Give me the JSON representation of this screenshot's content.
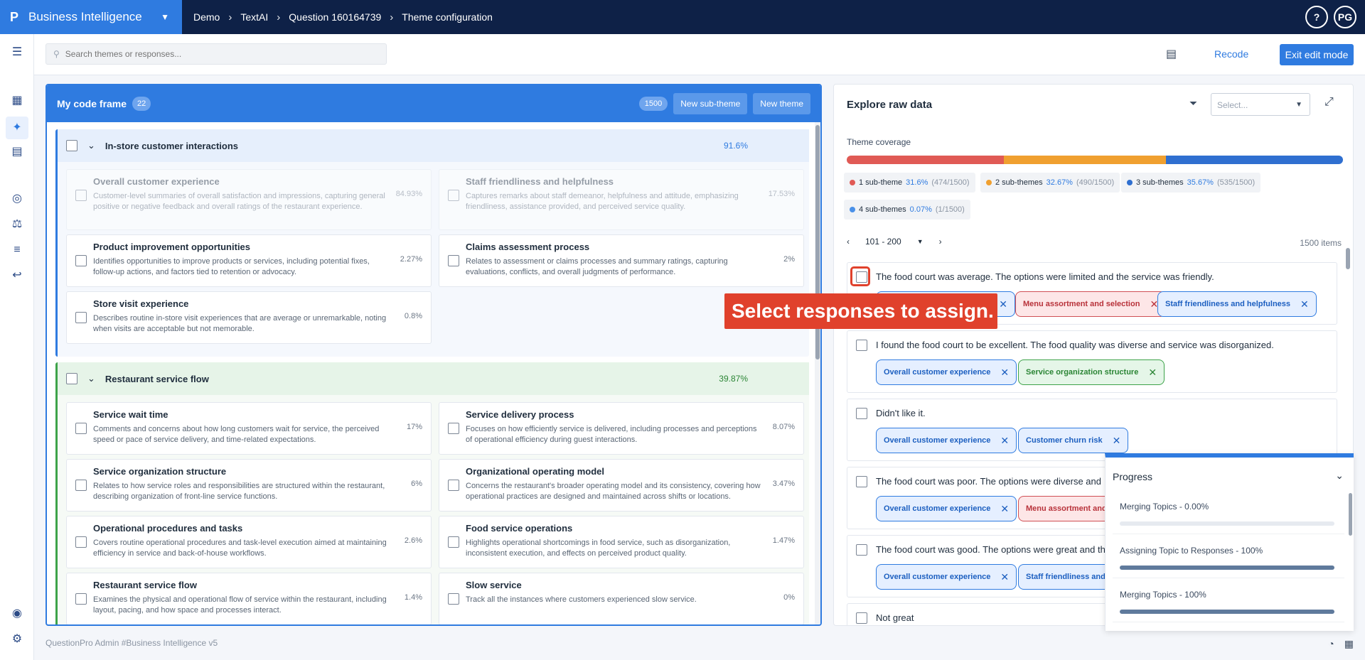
{
  "app": {
    "logo": "P",
    "name": "Business Intelligence"
  },
  "breadcrumbs": [
    "Demo",
    "TextAI",
    "Question 160164739",
    "Theme configuration"
  ],
  "topbar": {
    "help": "?",
    "user_initials": "PG"
  },
  "toolbar": {
    "search_placeholder": "Search themes or responses...",
    "recode": "Recode",
    "exit": "Exit edit mode"
  },
  "codeframe": {
    "title": "My code frame",
    "badge": "22",
    "count": "1500",
    "new_sub_theme": "New sub-theme",
    "new_theme": "New theme",
    "groups": [
      {
        "title": "In-store customer interactions",
        "pct": "91.6%",
        "subs": [
          {
            "title": "Overall customer experience",
            "desc": "Customer-level summaries of overall satisfaction and impressions, capturing general positive or negative feedback and overall ratings of the restaurant experience.",
            "pct": "84.93%"
          },
          {
            "title": "Staff friendliness and helpfulness",
            "desc": "Captures remarks about staff demeanor, helpfulness and attitude, emphasizing friendliness, assistance provided, and perceived service quality.",
            "pct": "17.53%"
          },
          {
            "title": "Product improvement opportunities",
            "desc": "Identifies opportunities to improve products or services, including potential fixes, follow-up actions, and factors tied to retention or advocacy.",
            "pct": "2.27%"
          },
          {
            "title": "Claims assessment process",
            "desc": "Relates to assessment or claims processes and summary ratings, capturing evaluations, conflicts, and overall judgments of performance.",
            "pct": "2%"
          },
          {
            "title": "Store visit experience",
            "desc": "Describes routine in-store visit experiences that are average or unremarkable, noting when visits are acceptable but not memorable.",
            "pct": "0.8%"
          }
        ]
      },
      {
        "title": "Restaurant service flow",
        "pct": "39.87%",
        "subs": [
          {
            "title": "Service wait time",
            "desc": "Comments and concerns about how long customers wait for service, the perceived speed or pace of service delivery, and time-related expectations.",
            "pct": "17%"
          },
          {
            "title": "Service delivery process",
            "desc": "Focuses on how efficiently service is delivered, including processes and perceptions of operational efficiency during guest interactions.",
            "pct": "8.07%"
          },
          {
            "title": "Service organization structure",
            "desc": "Relates to how service roles and responsibilities are structured within the restaurant, describing organization of front-line service functions.",
            "pct": "6%"
          },
          {
            "title": "Organizational operating model",
            "desc": "Concerns the restaurant's broader operating model and its consistency, covering how operational practices are designed and maintained across shifts or locations.",
            "pct": "3.47%"
          },
          {
            "title": "Operational procedures and tasks",
            "desc": "Covers routine operational procedures and task-level execution aimed at maintaining efficiency in service and back-of-house workflows.",
            "pct": "2.6%"
          },
          {
            "title": "Food service operations",
            "desc": "Highlights operational shortcomings in food service, such as disorganization, inconsistent execution, and effects on perceived product quality.",
            "pct": "1.47%"
          },
          {
            "title": "Restaurant service flow",
            "desc": "Examines the physical and operational flow of service within the restaurant, including layout, pacing, and how space and processes interact.",
            "pct": "1.4%"
          },
          {
            "title": "Slow service",
            "desc": "Track all the instances where customers experienced slow service.",
            "pct": "0%"
          }
        ]
      }
    ]
  },
  "explore": {
    "title": "Explore raw data",
    "select_placeholder": "Select...",
    "coverage_label": "Theme coverage",
    "coverage": [
      {
        "label": "1 sub-theme",
        "pct": "31.6%",
        "count": "(474/1500)",
        "fraction": 0.316,
        "color": "#e05a55"
      },
      {
        "label": "2 sub-themes",
        "pct": "32.67%",
        "count": "(490/1500)",
        "fraction": 0.3267,
        "color": "#f0a030"
      },
      {
        "label": "3 sub-themes",
        "pct": "35.67%",
        "count": "(535/1500)",
        "fraction": 0.3567,
        "color": "#2f6fd0"
      },
      {
        "label": "4 sub-themes",
        "pct": "0.07%",
        "count": "(1/1500)",
        "fraction": 0.0007,
        "color": "#4a90e8"
      }
    ],
    "range": "101 - 200",
    "items": "1500 items",
    "responses": [
      {
        "text": "The food court was average. The options were limited and the service was friendly.",
        "chips": [
          {
            "label": "Menu assortment and selection",
            "color": "red"
          },
          {
            "label": "Staff friendliness and helpfulness",
            "color": "blue"
          }
        ]
      },
      {
        "text": "I found the food court to be excellent. The food quality was diverse and service was disorganized.",
        "chips": [
          {
            "label": "Overall customer experience",
            "color": "blue"
          },
          {
            "label": "Service organization structure",
            "color": "green"
          }
        ]
      },
      {
        "text": "Didn't like it.",
        "chips": [
          {
            "label": "Overall customer experience",
            "color": "blue"
          },
          {
            "label": "Customer churn risk",
            "color": "blue"
          }
        ]
      },
      {
        "text": "The food court was poor. The options were diverse and",
        "chips": [
          {
            "label": "Overall customer experience",
            "color": "blue"
          },
          {
            "label": "Menu assortment and s",
            "color": "red"
          }
        ]
      },
      {
        "text": "The food court was good. The options were great and th",
        "chips": [
          {
            "label": "Overall customer experience",
            "color": "blue"
          },
          {
            "label": "Staff friendliness and h",
            "color": "blue"
          }
        ]
      },
      {
        "text": "Not great",
        "chips": []
      }
    ]
  },
  "tooltip": "Select responses to assign.",
  "progress": {
    "title": "Progress",
    "items": [
      {
        "label": "Merging Topics - 0.00%",
        "fraction": 0.0
      },
      {
        "label": "Assigning Topic to Responses - 100%",
        "fraction": 1.0
      },
      {
        "label": "Merging Topics - 100%",
        "fraction": 1.0
      }
    ]
  },
  "footer": {
    "prefix": "QuestionPro Admin",
    "link": "#Business Intelligence v5"
  }
}
